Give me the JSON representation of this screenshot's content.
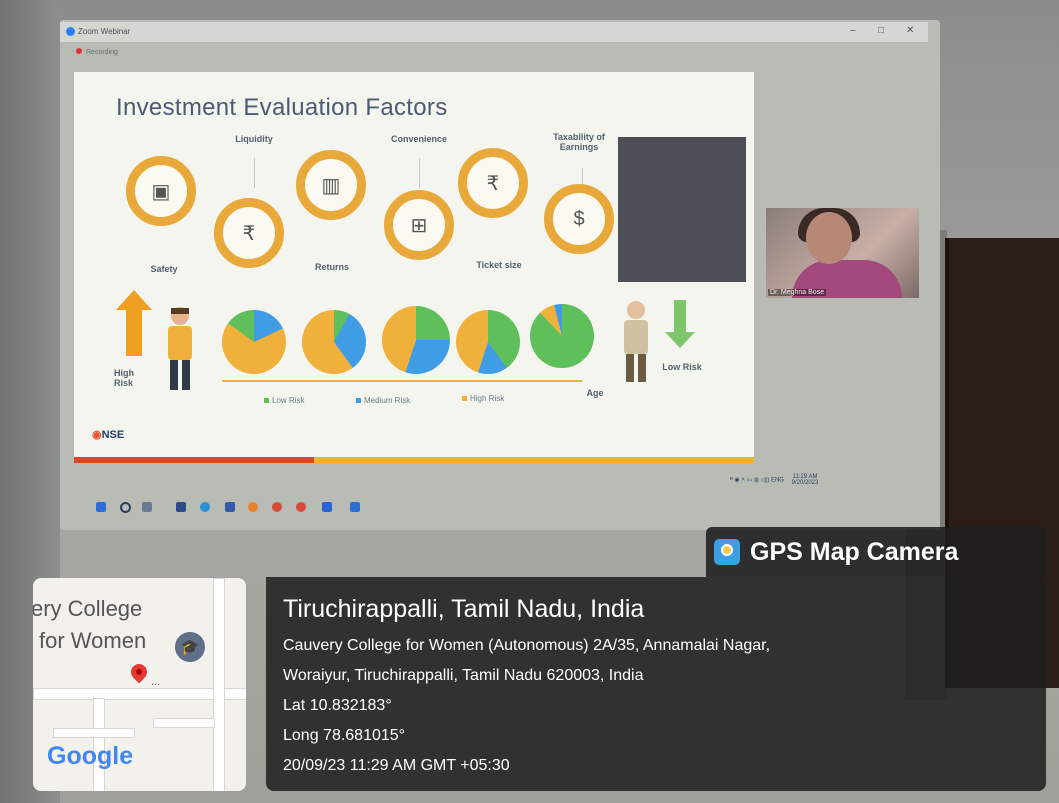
{
  "zoom": {
    "window_title": "Zoom Webinar",
    "recording_label": "Recording",
    "controls": [
      "–",
      "□",
      "✕"
    ]
  },
  "slide": {
    "title": "Investment Evaluation Factors",
    "factors": [
      "Safety",
      "Liquidity",
      "Returns",
      "Convenience",
      "Ticket size",
      "Taxability of Earnings"
    ],
    "high_risk_label": "High Risk",
    "low_risk_label": "Low Risk",
    "age_label": "Age",
    "legend": [
      "Low Risk",
      "Medium Risk",
      "High Risk"
    ],
    "logo": "NSE",
    "colors": {
      "low": "#5fbf5a",
      "medium": "#3f9de6",
      "high": "#f0b13c",
      "ring": "#e9a83a"
    }
  },
  "video_tile": {
    "name": "Dr. Meghna Bose"
  },
  "tray": {
    "lang": "ENG",
    "time": "11:29 AM",
    "date": "9/20/2023"
  },
  "overlay": {
    "brand": "GPS Map Camera",
    "city_line": "Tiruchirappalli, Tamil Nadu, India",
    "address_1": "Cauvery College for Women (Autonomous) 2A/35, Annamalai Nagar,",
    "address_2": "Woraiyur, Tiruchirappalli, Tamil Nadu 620003, India",
    "lat": "Lat 10.832183°",
    "long": "Long 78.681015°",
    "datetime": "20/09/23 11:29 AM GMT +05:30"
  },
  "map": {
    "label_line1": "ery College",
    "label_line2": "for Women",
    "pin_more": "...",
    "provider": "Google"
  }
}
